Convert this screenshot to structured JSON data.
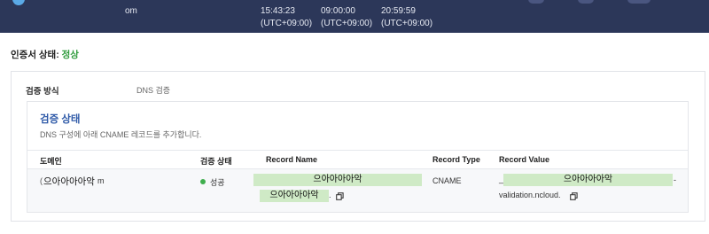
{
  "top_bar": {
    "col1": "om",
    "col2_time": "15:43:23",
    "col2_tz": "(UTC+09:00)",
    "col3_time": "09:00:00",
    "col3_tz": "(UTC+09:00)",
    "col4_time": "20:59:59",
    "col4_tz": "(UTC+09:00)"
  },
  "cert_status": {
    "label": "인증서 상태:",
    "value": "정상",
    "value_color": "#2e9b3c"
  },
  "method": {
    "label": "검증 방식",
    "value": "DNS 검증"
  },
  "verification": {
    "title": "검증 상태",
    "description": "DNS 구성에 아래 CNAME 레코드를 추가합니다.",
    "columns": [
      "도메인",
      "검증 상태",
      "Record Name",
      "Record Type",
      "Record Value"
    ],
    "row": {
      "domain_prefix": "(",
      "domain_masked": "으아아아아악",
      "domain_suffix": "m",
      "status": "성공",
      "record_name_mask1": "으아아아아악",
      "record_name_mask2": "으아아아아악",
      "record_name_tail": ".",
      "record_type": "CNAME",
      "record_value_prefix": "_",
      "record_value_mask": "으아아아아악",
      "record_value_suffix": "-",
      "record_value_line2": "validation.ncloud."
    }
  },
  "colors": {
    "header_bg": "#2c3759",
    "accent_blue": "#2f5aa8",
    "success_green": "#3fae4d",
    "mask_green": "#cfeac6"
  }
}
